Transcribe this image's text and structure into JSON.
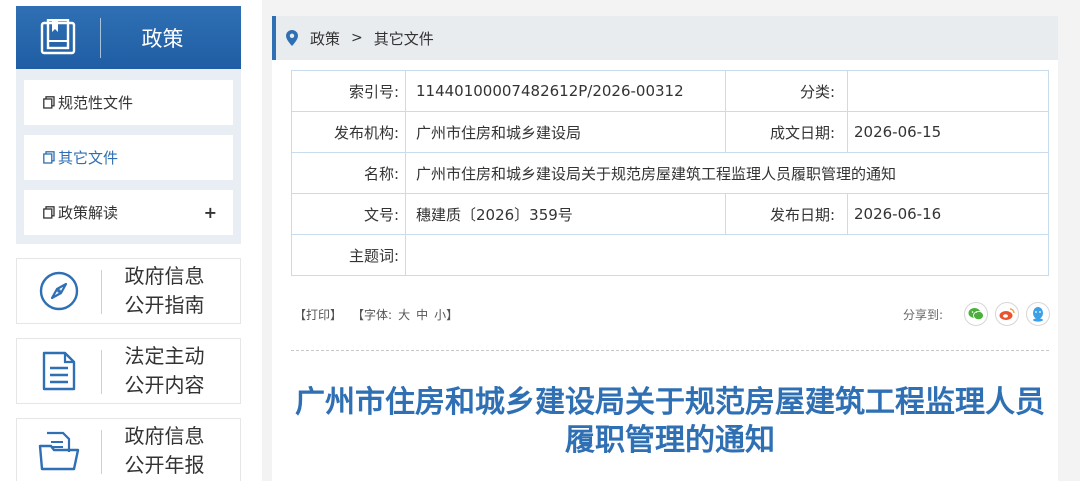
{
  "sidebar": {
    "header": {
      "title": "政策",
      "icon": "policy-book-icon"
    },
    "items": [
      {
        "label": "规范性文件",
        "icon": "document-icon",
        "active": false
      },
      {
        "label": "其它文件",
        "icon": "document-icon",
        "active": true
      },
      {
        "label": "政策解读",
        "icon": "document-icon",
        "active": false,
        "expand": "+"
      }
    ],
    "cards": [
      {
        "line1": "政府信息",
        "line2": "公开指南",
        "icon": "compass-icon"
      },
      {
        "line1": "法定主动",
        "line2": "公开内容",
        "icon": "document-lines-icon"
      },
      {
        "line1": "政府信息",
        "line2": "公开年报",
        "icon": "folder-icon"
      }
    ]
  },
  "breadcrumb": {
    "icon": "location-pin-icon",
    "items": [
      "政策",
      "其它文件"
    ],
    "separator": ">"
  },
  "meta": {
    "index_label": "索引号:",
    "index_value": "11440100007482612P/2026-00312",
    "category_label": "分类:",
    "category_value": "",
    "issuer_label": "发布机构:",
    "issuer_value": "广州市住房和城乡建设局",
    "created_label": "成文日期:",
    "created_value": "2026-06-15",
    "name_label": "名称:",
    "name_value": "广州市住房和城乡建设局关于规范房屋建筑工程监理人员履职管理的通知",
    "docno_label": "文号:",
    "docno_value": "穗建质〔2026〕359号",
    "published_label": "发布日期:",
    "published_value": "2026-06-16",
    "subject_label": "主题词:",
    "subject_value": ""
  },
  "toolbar": {
    "print": "【打印】",
    "font_prefix": "【字体:",
    "font_large": "大",
    "font_medium": "中",
    "font_small": "小",
    "font_suffix": "】",
    "share_label": "分享到:",
    "share_icons": [
      "wechat-icon",
      "weibo-icon",
      "qq-icon"
    ]
  },
  "document": {
    "title_line1": "广州市住房和城乡建设局关于规范房屋建筑工程监理人员",
    "title_line2": "履职管理的通知"
  },
  "colors": {
    "primary": "#2f6fb3",
    "sidebar_bg": "#e8eef4",
    "border": "#c9dcee",
    "wechat": "#4caf3d",
    "weibo": "#e8542e",
    "qq": "#3aa0e8"
  }
}
